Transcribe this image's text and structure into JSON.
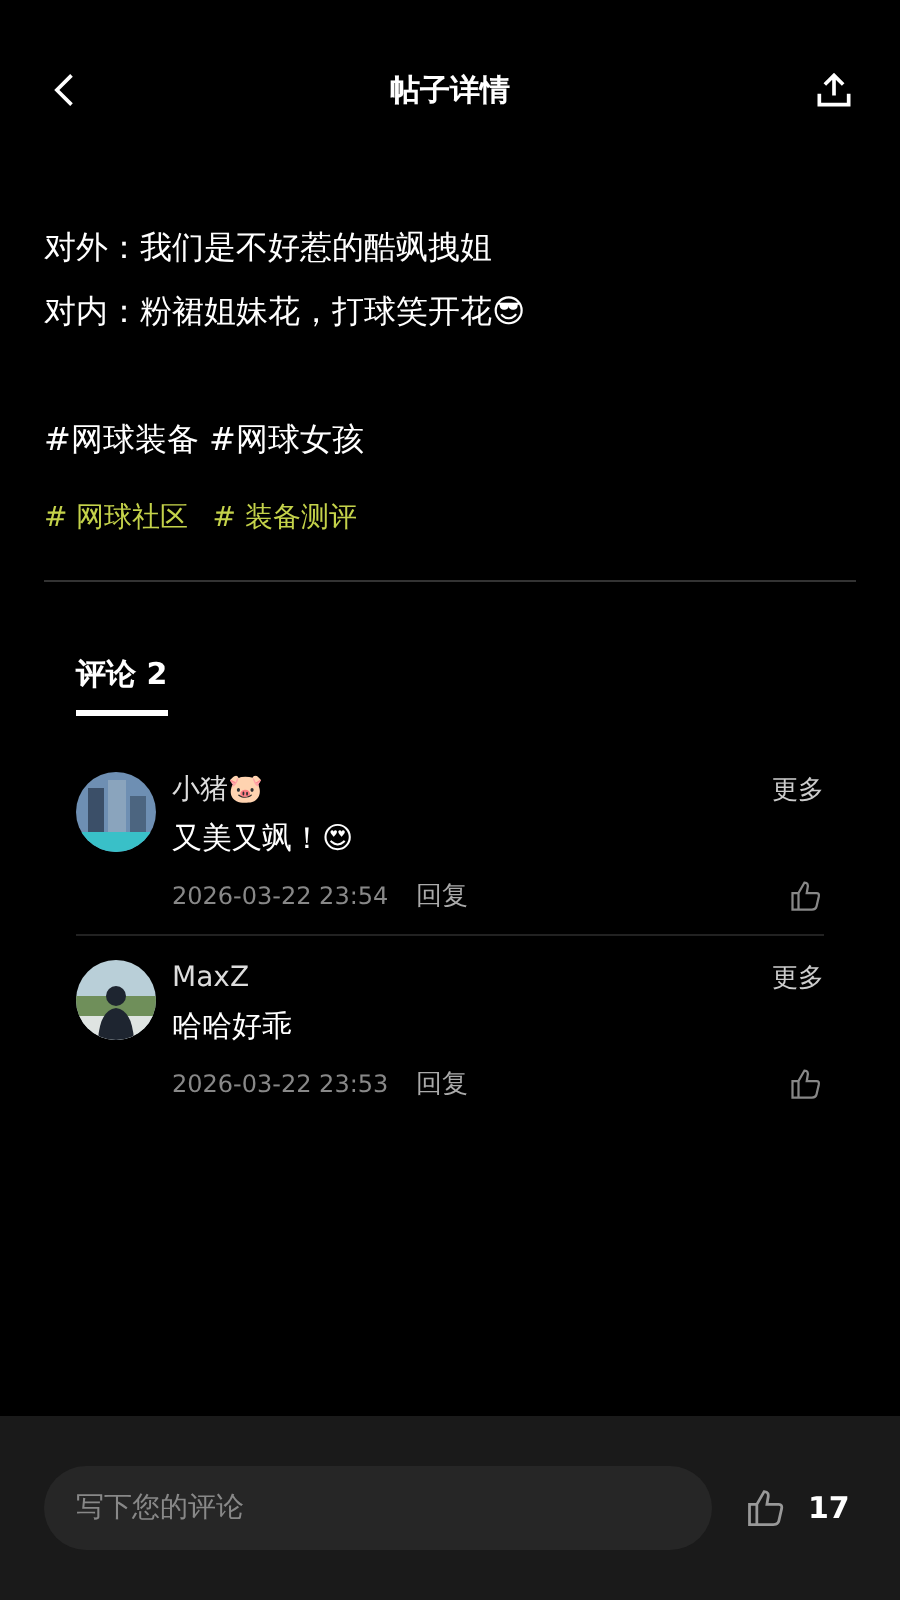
{
  "header": {
    "title": "帖子详情"
  },
  "post": {
    "lines": [
      "对外：我们是不好惹的酷飒拽姐",
      "对内：粉裙姐妹花，打球笑开花😎"
    ],
    "hashtags": "#网球装备 #网球女孩",
    "topics": [
      "# 网球社区",
      "# 装备测评"
    ]
  },
  "comments_tab": {
    "label": "评论 2",
    "selected": true
  },
  "comments": [
    {
      "author": "小猪🐷",
      "text": "又美又飒！😍",
      "time": "2026-03-22 23:54",
      "reply": "回复",
      "more": "更多"
    },
    {
      "author": "MaxZ",
      "text": "哈哈好乖",
      "time": "2026-03-22 23:53",
      "reply": "回复",
      "more": "更多"
    }
  ],
  "bottom_bar": {
    "placeholder": "写下您的评论",
    "likes": "17"
  }
}
